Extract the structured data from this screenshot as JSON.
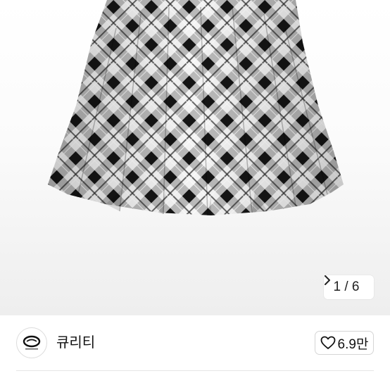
{
  "product_image": {
    "pager_text": "1 / 6",
    "icon": "chevron-right-icon"
  },
  "seller": {
    "name": "큐리티",
    "avatar_icon": "shop-logo"
  },
  "like": {
    "count": "6.9만",
    "icon": "heart-outline-icon"
  },
  "colors": {
    "plaid_dark": "#1a1a1a",
    "plaid_light": "#f2f2f2",
    "pager_bg": "#ffffff"
  }
}
